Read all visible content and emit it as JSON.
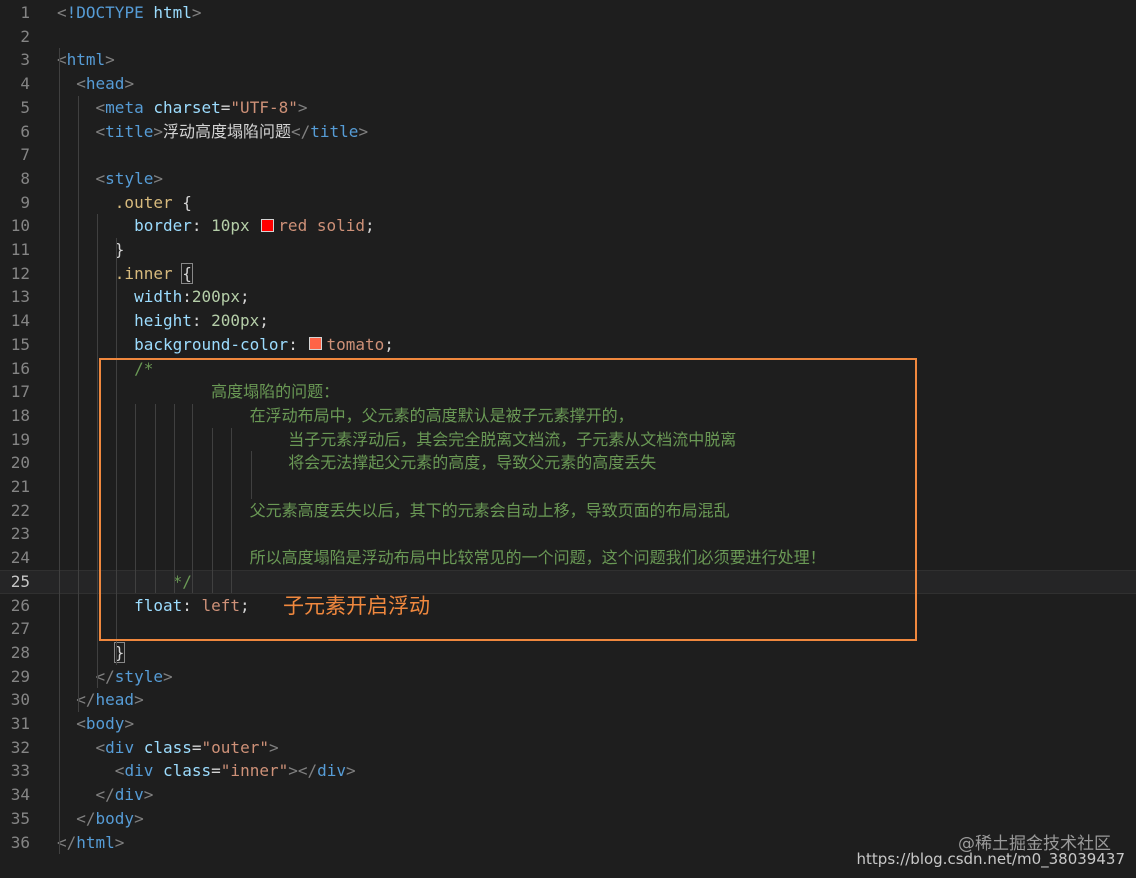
{
  "lines": [
    {
      "n": "1",
      "tokens": [
        {
          "c": "pun",
          "t": "<"
        },
        {
          "c": "tag",
          "t": "!DOCTYPE"
        },
        {
          "c": "txt",
          "t": " "
        },
        {
          "c": "attr",
          "t": "html"
        },
        {
          "c": "pun",
          "t": ">"
        }
      ]
    },
    {
      "n": "2",
      "tokens": []
    },
    {
      "n": "3",
      "tokens": [
        {
          "c": "pun",
          "t": "<"
        },
        {
          "c": "tag",
          "t": "html"
        },
        {
          "c": "pun",
          "t": ">"
        }
      ]
    },
    {
      "n": "4",
      "tokens": [
        {
          "c": "txt",
          "t": "  "
        },
        {
          "c": "pun",
          "t": "<"
        },
        {
          "c": "tag",
          "t": "head"
        },
        {
          "c": "pun",
          "t": ">"
        }
      ]
    },
    {
      "n": "5",
      "tokens": [
        {
          "c": "txt",
          "t": "    "
        },
        {
          "c": "pun",
          "t": "<"
        },
        {
          "c": "tag",
          "t": "meta"
        },
        {
          "c": "txt",
          "t": " "
        },
        {
          "c": "attr",
          "t": "charset"
        },
        {
          "c": "txt",
          "t": "="
        },
        {
          "c": "str",
          "t": "\"UTF-8\""
        },
        {
          "c": "pun",
          "t": ">"
        }
      ]
    },
    {
      "n": "6",
      "tokens": [
        {
          "c": "txt",
          "t": "    "
        },
        {
          "c": "pun",
          "t": "<"
        },
        {
          "c": "tag",
          "t": "title"
        },
        {
          "c": "pun",
          "t": ">"
        },
        {
          "c": "txt",
          "t": "浮动高度塌陷问题"
        },
        {
          "c": "pun",
          "t": "</"
        },
        {
          "c": "tag",
          "t": "title"
        },
        {
          "c": "pun",
          "t": ">"
        }
      ]
    },
    {
      "n": "7",
      "tokens": []
    },
    {
      "n": "8",
      "tokens": [
        {
          "c": "txt",
          "t": "    "
        },
        {
          "c": "pun",
          "t": "<"
        },
        {
          "c": "tag",
          "t": "style"
        },
        {
          "c": "pun",
          "t": ">"
        }
      ]
    },
    {
      "n": "9",
      "tokens": [
        {
          "c": "txt",
          "t": "      "
        },
        {
          "c": "sel",
          "t": ".outer"
        },
        {
          "c": "txt",
          "t": " {"
        }
      ]
    },
    {
      "n": "10",
      "tokens": [
        {
          "c": "txt",
          "t": "        "
        },
        {
          "c": "prop",
          "t": "border"
        },
        {
          "c": "txt",
          "t": ": "
        },
        {
          "c": "num",
          "t": "10px"
        },
        {
          "c": "txt",
          "t": " "
        },
        {
          "c": "swatch",
          "t": "#ff0000"
        },
        {
          "c": "val",
          "t": "red solid"
        },
        {
          "c": "txt",
          "t": ";"
        }
      ]
    },
    {
      "n": "11",
      "tokens": [
        {
          "c": "txt",
          "t": "      }"
        }
      ]
    },
    {
      "n": "12",
      "tokens": [
        {
          "c": "txt",
          "t": "      "
        },
        {
          "c": "sel",
          "t": ".inner"
        },
        {
          "c": "txt",
          "t": " "
        },
        {
          "c": "bracket",
          "t": "{"
        }
      ]
    },
    {
      "n": "13",
      "tokens": [
        {
          "c": "txt",
          "t": "        "
        },
        {
          "c": "prop",
          "t": "width"
        },
        {
          "c": "txt",
          "t": ":"
        },
        {
          "c": "num",
          "t": "200px"
        },
        {
          "c": "txt",
          "t": ";"
        }
      ]
    },
    {
      "n": "14",
      "tokens": [
        {
          "c": "txt",
          "t": "        "
        },
        {
          "c": "prop",
          "t": "height"
        },
        {
          "c": "txt",
          "t": ": "
        },
        {
          "c": "num",
          "t": "200px"
        },
        {
          "c": "txt",
          "t": ";"
        }
      ]
    },
    {
      "n": "15",
      "tokens": [
        {
          "c": "txt",
          "t": "        "
        },
        {
          "c": "prop",
          "t": "background-color"
        },
        {
          "c": "txt",
          "t": ": "
        },
        {
          "c": "swatch",
          "t": "#ff6347"
        },
        {
          "c": "val",
          "t": "tomato"
        },
        {
          "c": "txt",
          "t": ";"
        }
      ]
    },
    {
      "n": "16",
      "tokens": [
        {
          "c": "txt",
          "t": "        "
        },
        {
          "c": "com",
          "t": "/*"
        }
      ]
    },
    {
      "n": "17",
      "tokens": [
        {
          "c": "txt",
          "t": "                "
        },
        {
          "c": "com",
          "t": "高度塌陷的问题："
        }
      ]
    },
    {
      "n": "18",
      "tokens": [
        {
          "c": "txt",
          "t": "                    "
        },
        {
          "c": "com",
          "t": "在浮动布局中，父元素的高度默认是被子元素撑开的，"
        }
      ]
    },
    {
      "n": "19",
      "tokens": [
        {
          "c": "txt",
          "t": "                        "
        },
        {
          "c": "com",
          "t": "当子元素浮动后，其会完全脱离文档流，子元素从文档流中脱离"
        }
      ]
    },
    {
      "n": "20",
      "tokens": [
        {
          "c": "txt",
          "t": "                        "
        },
        {
          "c": "com",
          "t": "将会无法撑起父元素的高度，导致父元素的高度丢失"
        }
      ]
    },
    {
      "n": "21",
      "tokens": []
    },
    {
      "n": "22",
      "tokens": [
        {
          "c": "txt",
          "t": "                    "
        },
        {
          "c": "com",
          "t": "父元素高度丢失以后，其下的元素会自动上移，导致页面的布局混乱"
        }
      ]
    },
    {
      "n": "23",
      "tokens": []
    },
    {
      "n": "24",
      "tokens": [
        {
          "c": "txt",
          "t": "                    "
        },
        {
          "c": "com",
          "t": "所以高度塌陷是浮动布局中比较常见的一个问题，这个问题我们必须要进行处理！"
        }
      ]
    },
    {
      "n": "25",
      "tokens": [
        {
          "c": "txt",
          "t": "            "
        },
        {
          "c": "com",
          "t": "*/"
        }
      ]
    },
    {
      "n": "26",
      "tokens": [
        {
          "c": "txt",
          "t": "        "
        },
        {
          "c": "prop",
          "t": "float"
        },
        {
          "c": "txt",
          "t": ": "
        },
        {
          "c": "val",
          "t": "left"
        },
        {
          "c": "txt",
          "t": ";"
        }
      ]
    },
    {
      "n": "27",
      "tokens": []
    },
    {
      "n": "28",
      "tokens": [
        {
          "c": "txt",
          "t": "      "
        },
        {
          "c": "bracket",
          "t": "}"
        }
      ]
    },
    {
      "n": "29",
      "tokens": [
        {
          "c": "txt",
          "t": "    "
        },
        {
          "c": "pun",
          "t": "</"
        },
        {
          "c": "tag",
          "t": "style"
        },
        {
          "c": "pun",
          "t": ">"
        }
      ]
    },
    {
      "n": "30",
      "tokens": [
        {
          "c": "txt",
          "t": "  "
        },
        {
          "c": "pun",
          "t": "</"
        },
        {
          "c": "tag",
          "t": "head"
        },
        {
          "c": "pun",
          "t": ">"
        }
      ]
    },
    {
      "n": "31",
      "tokens": [
        {
          "c": "txt",
          "t": "  "
        },
        {
          "c": "pun",
          "t": "<"
        },
        {
          "c": "tag",
          "t": "body"
        },
        {
          "c": "pun",
          "t": ">"
        }
      ]
    },
    {
      "n": "32",
      "tokens": [
        {
          "c": "txt",
          "t": "    "
        },
        {
          "c": "pun",
          "t": "<"
        },
        {
          "c": "tag",
          "t": "div"
        },
        {
          "c": "txt",
          "t": " "
        },
        {
          "c": "attr",
          "t": "class"
        },
        {
          "c": "txt",
          "t": "="
        },
        {
          "c": "str",
          "t": "\"outer\""
        },
        {
          "c": "pun",
          "t": ">"
        }
      ]
    },
    {
      "n": "33",
      "tokens": [
        {
          "c": "txt",
          "t": "      "
        },
        {
          "c": "pun",
          "t": "<"
        },
        {
          "c": "tag",
          "t": "div"
        },
        {
          "c": "txt",
          "t": " "
        },
        {
          "c": "attr",
          "t": "class"
        },
        {
          "c": "txt",
          "t": "="
        },
        {
          "c": "str",
          "t": "\"inner\""
        },
        {
          "c": "pun",
          "t": "></"
        },
        {
          "c": "tag",
          "t": "div"
        },
        {
          "c": "pun",
          "t": ">"
        }
      ]
    },
    {
      "n": "34",
      "tokens": [
        {
          "c": "txt",
          "t": "    "
        },
        {
          "c": "pun",
          "t": "</"
        },
        {
          "c": "tag",
          "t": "div"
        },
        {
          "c": "pun",
          "t": ">"
        }
      ]
    },
    {
      "n": "35",
      "tokens": [
        {
          "c": "txt",
          "t": "  "
        },
        {
          "c": "pun",
          "t": "</"
        },
        {
          "c": "tag",
          "t": "body"
        },
        {
          "c": "pun",
          "t": ">"
        }
      ]
    },
    {
      "n": "36",
      "tokens": [
        {
          "c": "pun",
          "t": "</"
        },
        {
          "c": "tag",
          "t": "html"
        },
        {
          "c": "pun",
          "t": ">"
        }
      ]
    }
  ],
  "current_line": "25",
  "annotation": "子元素开启浮动",
  "watermark": {
    "line1": "@稀土掘金技术社区",
    "line2": "https://blog.csdn.net/m0_38039437"
  },
  "colors": {
    "background": "#1e1e1e",
    "highlight_box": "#f0883e"
  }
}
